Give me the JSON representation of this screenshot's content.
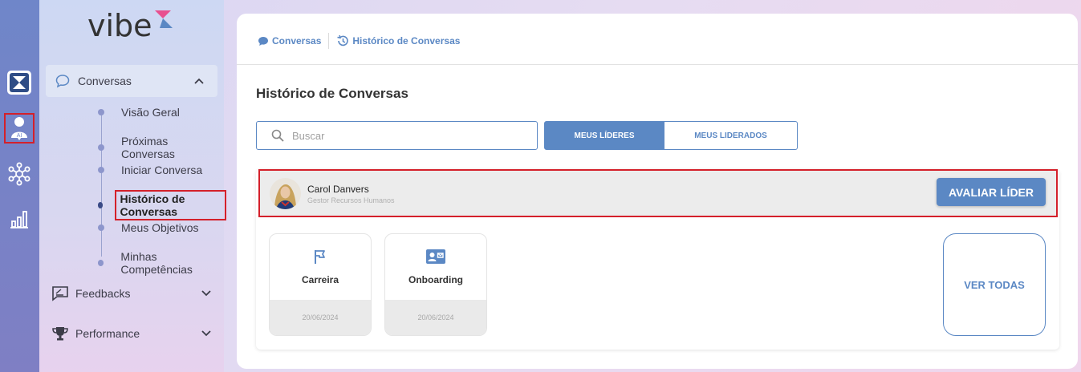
{
  "brand": {
    "logo_text": "vibe",
    "accent": "#5b88c4",
    "highlight": "#d4202a"
  },
  "rail": {
    "icons": [
      "hourglass-icon",
      "ai-person-icon",
      "network-icon",
      "bar-chart-icon"
    ]
  },
  "sidebar": {
    "conversas": {
      "label": "Conversas",
      "items": [
        {
          "label": "Visão Geral"
        },
        {
          "label": "Próximas Conversas"
        },
        {
          "label": "Iniciar Conversa"
        },
        {
          "label": "Histórico de Conversas",
          "active": true
        },
        {
          "label": "Meus Objetivos"
        },
        {
          "label": "Minhas Competências"
        }
      ]
    },
    "feedbacks": {
      "label": "Feedbacks"
    },
    "performance": {
      "label": "Performance"
    }
  },
  "breadcrumb": {
    "first": "Conversas",
    "second": "Histórico de Conversas"
  },
  "main": {
    "title": "Histórico de Conversas",
    "search_placeholder": "Buscar",
    "tab_active": "MEUS LÍDERES",
    "tab_inactive": "MEUS LIDERADOS",
    "leader": {
      "name": "Carol Danvers",
      "role": "Gestor Recursos Humanos",
      "button": "AVALIAR LÍDER"
    },
    "cards": [
      {
        "title": "Carreira",
        "date": "20/06/2024",
        "icon": "flag-icon"
      },
      {
        "title": "Onboarding",
        "date": "20/06/2024",
        "icon": "id-card-icon"
      }
    ],
    "see_all": "VER TODAS"
  }
}
